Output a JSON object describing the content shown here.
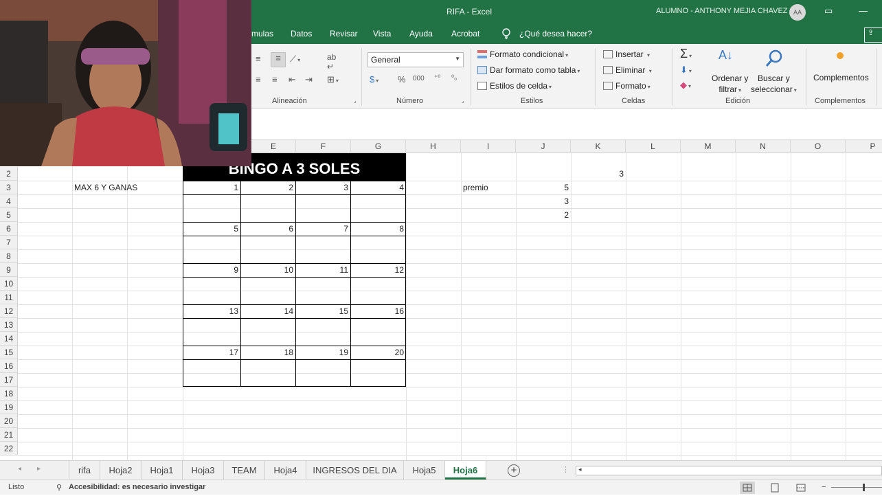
{
  "app": {
    "document_title": "RIFA  -  Excel",
    "user_name": "ALUMNO - ANTHONY MEJIA CHAVEZ",
    "user_initials": "AA",
    "accent_color": "#217346"
  },
  "menu_tabs": [
    "mulas",
    "Datos",
    "Revisar",
    "Vista",
    "Ayuda",
    "Acrobat"
  ],
  "tell_me": "¿Qué desea hacer?",
  "ribbon": {
    "alignment": {
      "label": "Alineación"
    },
    "number": {
      "label": "Número",
      "format_value": "General",
      "percent": "%",
      "thousands": "000"
    },
    "styles": {
      "label": "Estilos",
      "conditional_format": "Formato condicional",
      "format_as_table": "Dar formato como tabla",
      "cell_styles": "Estilos de celda"
    },
    "cells": {
      "label": "Celdas",
      "insert": "Insertar",
      "delete": "Eliminar",
      "format": "Formato"
    },
    "editing": {
      "label": "Edición",
      "sort_line1": "Ordenar y",
      "sort_line2": "filtrar",
      "find_line1": "Buscar y",
      "find_line2": "seleccionar"
    },
    "addins": {
      "label": "Complementos",
      "button": "Complementos"
    }
  },
  "columns": [
    "E",
    "F",
    "G",
    "H",
    "I",
    "J",
    "K",
    "L",
    "M",
    "N",
    "O",
    "P"
  ],
  "rows": [
    "2",
    "3",
    "4",
    "5",
    "6",
    "7",
    "8",
    "9",
    "10",
    "11",
    "12",
    "13",
    "14",
    "15",
    "16",
    "17",
    "18",
    "19",
    "20",
    "21",
    "22"
  ],
  "cells": {
    "bingo_title": "BINGO A 3 SOLES",
    "max_note": "MAX 6 Y GANAS",
    "premio_label": "premio",
    "j3": "5",
    "j4": "3",
    "j5": "2",
    "k2": "3"
  },
  "bingo_numbers": [
    [
      "1",
      "2",
      "3",
      "4"
    ],
    [
      "5",
      "6",
      "7",
      "8"
    ],
    [
      "9",
      "10",
      "11",
      "12"
    ],
    [
      "13",
      "14",
      "15",
      "16"
    ],
    [
      "17",
      "18",
      "19",
      "20"
    ]
  ],
  "sheet_tabs": [
    "rifa",
    "Hoja2",
    "Hoja1",
    "Hoja3",
    "TEAM",
    "Hoja4",
    "INGRESOS DEL DIA",
    "Hoja5",
    "Hoja6"
  ],
  "active_sheet": "Hoja6",
  "status": {
    "ready": "Listo",
    "accessibility": "Accesibilidad: es necesario investigar"
  }
}
